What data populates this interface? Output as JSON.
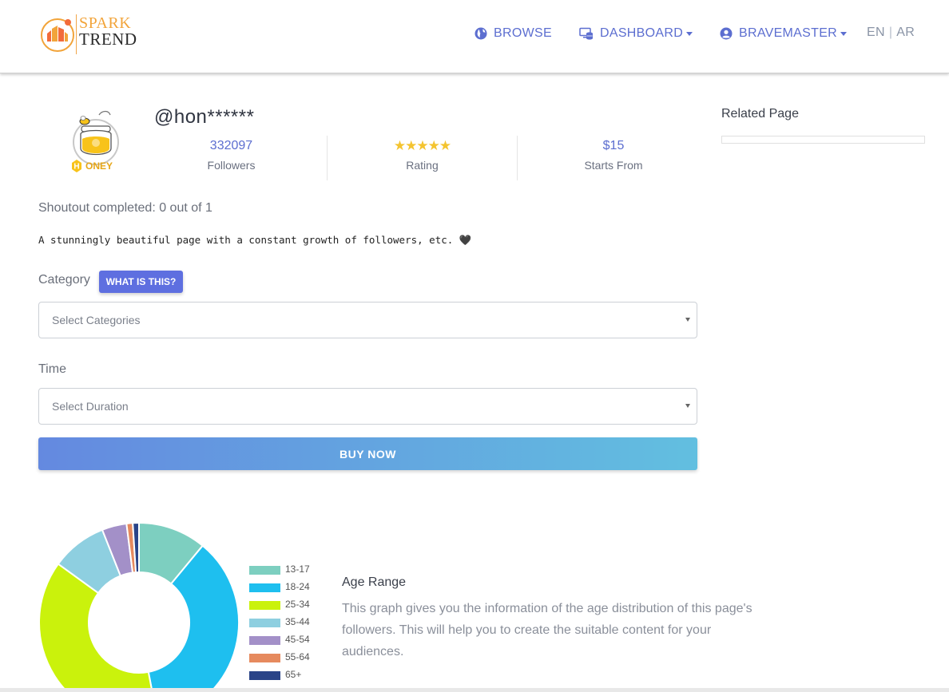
{
  "brand": {
    "line1": "SPARK",
    "line2": "TREND",
    "accent": "#f2a43a"
  },
  "nav": {
    "browse": {
      "label": "BROWSE",
      "icon": "globe-icon"
    },
    "dashboard": {
      "label": "DASHBOARD",
      "icon": "monitor-database-icon"
    },
    "user": {
      "label": "BRAVEMASTER",
      "icon": "user-circle-icon"
    },
    "lang": {
      "en": "EN",
      "separator": "|",
      "ar": "AR"
    }
  },
  "page": {
    "handle": "@hon******",
    "avatar_text": "ONEY",
    "avatar_letter": "H",
    "stats": {
      "followers": {
        "value": "332097",
        "label": "Followers"
      },
      "rating": {
        "stars": "★★★★★",
        "value": 5,
        "max": 5,
        "label": "Rating"
      },
      "price": {
        "value": "$15",
        "label": "Starts From"
      }
    },
    "shoutout": "Shoutout completed: 0 out of 1",
    "description": "A stunningly beautiful page with a constant growth of followers, etc. 🖤"
  },
  "form": {
    "category_label": "Category",
    "what_is_this": "WHAT IS THIS?",
    "category_placeholder": "Select Categories",
    "time_label": "Time",
    "time_placeholder": "Select Duration",
    "buy_label": "BUY NOW"
  },
  "related": {
    "title": "Related Page"
  },
  "age_section": {
    "title": "Age Range",
    "description": "This graph gives you the information of the age distribution of this page's followers. This will help you to create the suitable content for your audiences."
  },
  "chart_data": {
    "type": "pie",
    "donut": true,
    "categories": [
      "13-17",
      "18-24",
      "25-34",
      "35-44",
      "45-54",
      "55-64",
      "65+"
    ],
    "values": [
      11,
      36,
      38,
      9,
      4,
      1,
      1
    ],
    "colors": [
      "#7dcfc0",
      "#1ebfef",
      "#caf20c",
      "#8ecfe0",
      "#a390c8",
      "#e68a5e",
      "#2a4488"
    ],
    "legend_placement": "right"
  }
}
